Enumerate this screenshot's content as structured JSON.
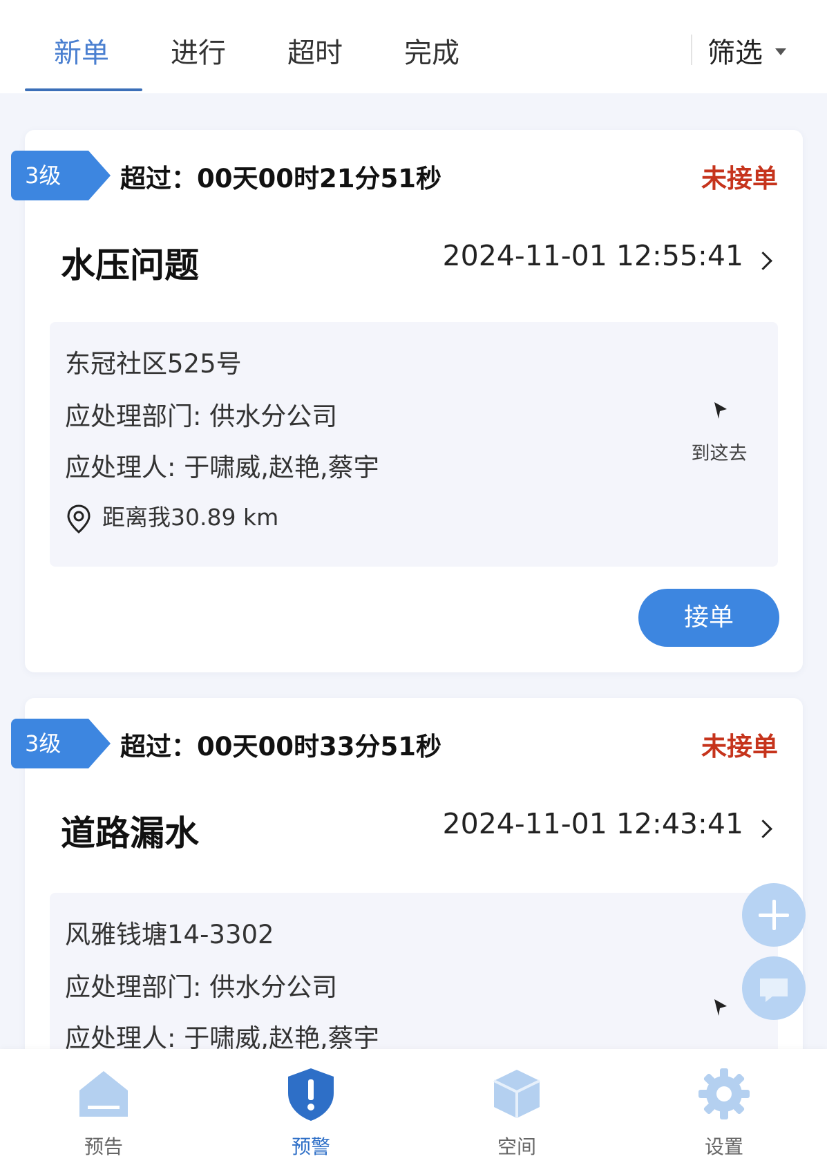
{
  "tabs": {
    "items": [
      {
        "label": "新单"
      },
      {
        "label": "进行"
      },
      {
        "label": "超时"
      },
      {
        "label": "完成"
      }
    ],
    "active_index": 0,
    "filter_label": "筛选"
  },
  "orders": [
    {
      "level": "3级",
      "overdue": "超过：00天00时21分51秒",
      "status": "未接单",
      "title": "水压问题",
      "time": "2024-11-01 12:55:41",
      "address": "东冠社区525号",
      "department": "应处理部门: 供水分公司",
      "handlers": "应处理人: 于啸威,赵艳,蔡宇",
      "distance": "距离我30.89 km",
      "nav_label": "到这去",
      "accept_label": "接单"
    },
    {
      "level": "3级",
      "overdue": "超过：00天00时33分51秒",
      "status": "未接单",
      "title": "道路漏水",
      "time": "2024-11-01 12:43:41",
      "address": "风雅钱塘14-3302",
      "department": "应处理部门: 供水分公司",
      "handlers": "应处理人: 于啸威,赵艳,蔡宇"
    }
  ],
  "bottom_nav": [
    {
      "label": "预告",
      "icon": "home-icon"
    },
    {
      "label": "预警",
      "icon": "shield-alert-icon",
      "active": true
    },
    {
      "label": "空间",
      "icon": "cube-icon"
    },
    {
      "label": "设置",
      "icon": "gear-icon"
    }
  ],
  "colors": {
    "accent": "#3d86e0",
    "status_red": "#c6341c",
    "active_tab": "#4a7fd0",
    "background": "#f3f5fb"
  }
}
